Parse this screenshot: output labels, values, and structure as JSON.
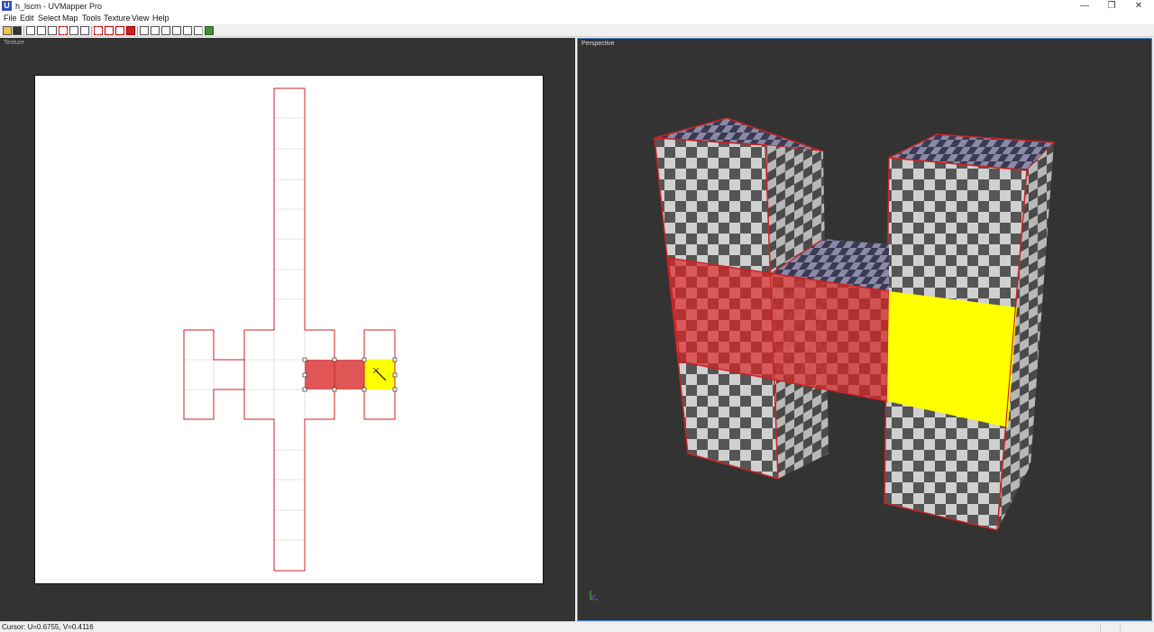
{
  "window": {
    "title": "h_lscm - UVMapper Pro",
    "icon_name": "uvmapper-app-icon",
    "controls": [
      "minimize",
      "restore",
      "close"
    ]
  },
  "menu": [
    {
      "label": "File"
    },
    {
      "label": "Edit"
    },
    {
      "label": "Select"
    },
    {
      "label": "Map"
    },
    {
      "label": "Tools"
    },
    {
      "label": "Texture"
    },
    {
      "label": "View"
    },
    {
      "label": "Help"
    }
  ],
  "toolbar": {
    "icons": [
      "open-icon",
      "save-icon",
      "undo-icon",
      "pan-icon",
      "zoom-icon",
      "select-rect-icon",
      "lasso-icon",
      "pointer-icon",
      "select-faces-icon",
      "deselect-icon",
      "select-all-icon",
      "delete-icon",
      "box-map-icon",
      "planar-map-icon",
      "cylindrical-map-icon",
      "spherical-map-icon",
      "stitch-icon",
      "settings-icon"
    ]
  },
  "panels": {
    "texture": {
      "label": "Texture"
    },
    "perspective": {
      "label": "Perspective"
    }
  },
  "status": {
    "cursor": "Cursor: U=0.6755, V=0.4116"
  },
  "colors": {
    "background": "#333333",
    "uv_edge": "#cc2222",
    "selected_face": "#e05555",
    "highlight_face": "#ffff00",
    "accent": "#4a86c8"
  }
}
